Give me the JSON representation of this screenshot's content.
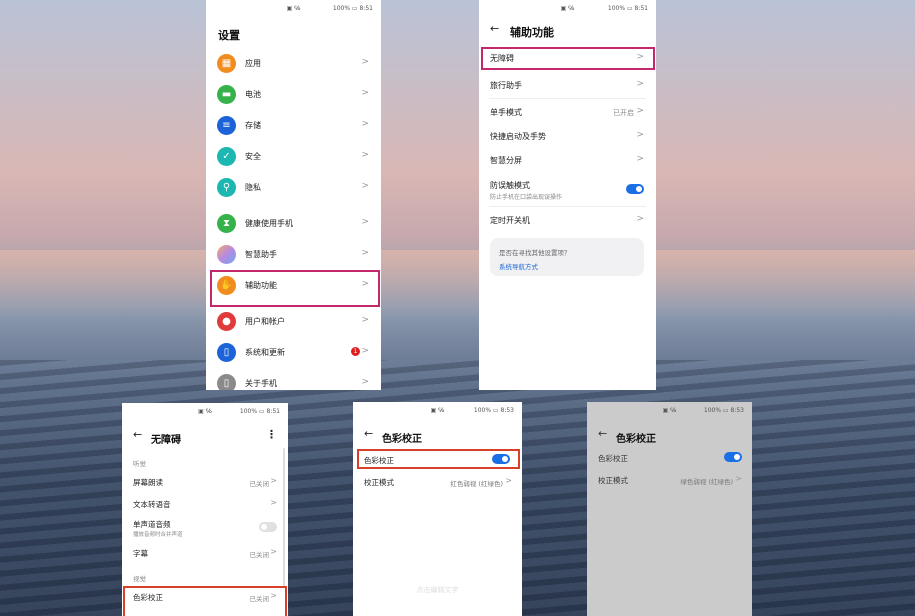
{
  "phone1": {
    "status_icons": "▣ ℅",
    "status_right": "100% ▭ 8:51",
    "title": "设置",
    "items": [
      {
        "label": "应用",
        "icon": "apps-icon",
        "color": "#f28c1e",
        "glyph": "▦"
      },
      {
        "label": "电池",
        "icon": "battery-icon",
        "color": "#35b34a",
        "glyph": "▬"
      },
      {
        "label": "存储",
        "icon": "storage-icon",
        "color": "#1c63d8",
        "glyph": "≡"
      },
      {
        "label": "安全",
        "icon": "security-icon",
        "color": "#1bb7b0",
        "glyph": "✓"
      },
      {
        "label": "隐私",
        "icon": "privacy-icon",
        "color": "#1bb7b0",
        "glyph": "⚲"
      },
      {
        "label": "健康使用手机",
        "icon": "hourglass-icon",
        "color": "#35b34a",
        "glyph": "⧗"
      },
      {
        "label": "智慧助手",
        "icon": "assistant-icon",
        "color": "#b58ae0",
        "glyph": "●"
      },
      {
        "label": "辅助功能",
        "icon": "hand-icon",
        "color": "#f28c1e",
        "glyph": "✋"
      },
      {
        "label": "用户和帐户",
        "icon": "user-icon",
        "color": "#e03a3a",
        "glyph": "●"
      },
      {
        "label": "系统和更新",
        "icon": "system-icon",
        "color": "#1c63d8",
        "glyph": "▯",
        "badge": "1"
      },
      {
        "label": "关于手机",
        "icon": "phone-icon",
        "color": "#8a8a8a",
        "glyph": "▯"
      }
    ]
  },
  "phone2": {
    "status_icons": "▣ ℅",
    "status_right": "100% ▭ 8:51",
    "title": "辅助功能",
    "items": [
      {
        "label": "无障碍"
      },
      {
        "label": "旅行助手"
      },
      {
        "label": "单手模式",
        "value": "已开启"
      },
      {
        "label": "快捷启动及手势"
      },
      {
        "label": "智慧分屏"
      },
      {
        "label": "防误触模式",
        "sub": "防止手机在口袋出现误操作",
        "toggle": "on"
      },
      {
        "label": "定时开关机"
      }
    ],
    "suggest_question": "是否在寻找其他设置项？",
    "suggest_link": "系统导航方式"
  },
  "phone3": {
    "status_icons": "▣ ℅",
    "status_right": "100% ▭ 8:51",
    "title": "无障碍",
    "section_vision": "听觉",
    "rows": [
      {
        "label": "屏幕朗读",
        "value": "已关闭"
      },
      {
        "label": "文本转语音"
      },
      {
        "label": "单声道音频",
        "sub": "播放音频时合并声道",
        "toggle": "off"
      },
      {
        "label": "字幕",
        "value": "已关闭"
      }
    ],
    "section_visual": "视觉",
    "color_row": {
      "label": "色彩校正",
      "value": "已关闭"
    }
  },
  "phone4": {
    "status_icons": "▣ ℅",
    "status_right": "100% ▭ 8:53",
    "title": "色彩校正",
    "toggle_label": "色彩校正",
    "mode_label": "校正模式",
    "mode_value": "红色弱视 (红绿色)",
    "hint": "点击编辑文字"
  },
  "phone5": {
    "status_icons": "▣ ℅",
    "status_right": "100% ▭ 8:53",
    "title": "色彩校正",
    "toggle_label": "色彩校正",
    "mode_label": "校正模式",
    "mode_value": "绿色弱视 (红绿色)"
  },
  "colors": {
    "highlight_pink": "#c2286b",
    "highlight_red": "#d8402a",
    "accent_blue": "#1a6fe6"
  }
}
